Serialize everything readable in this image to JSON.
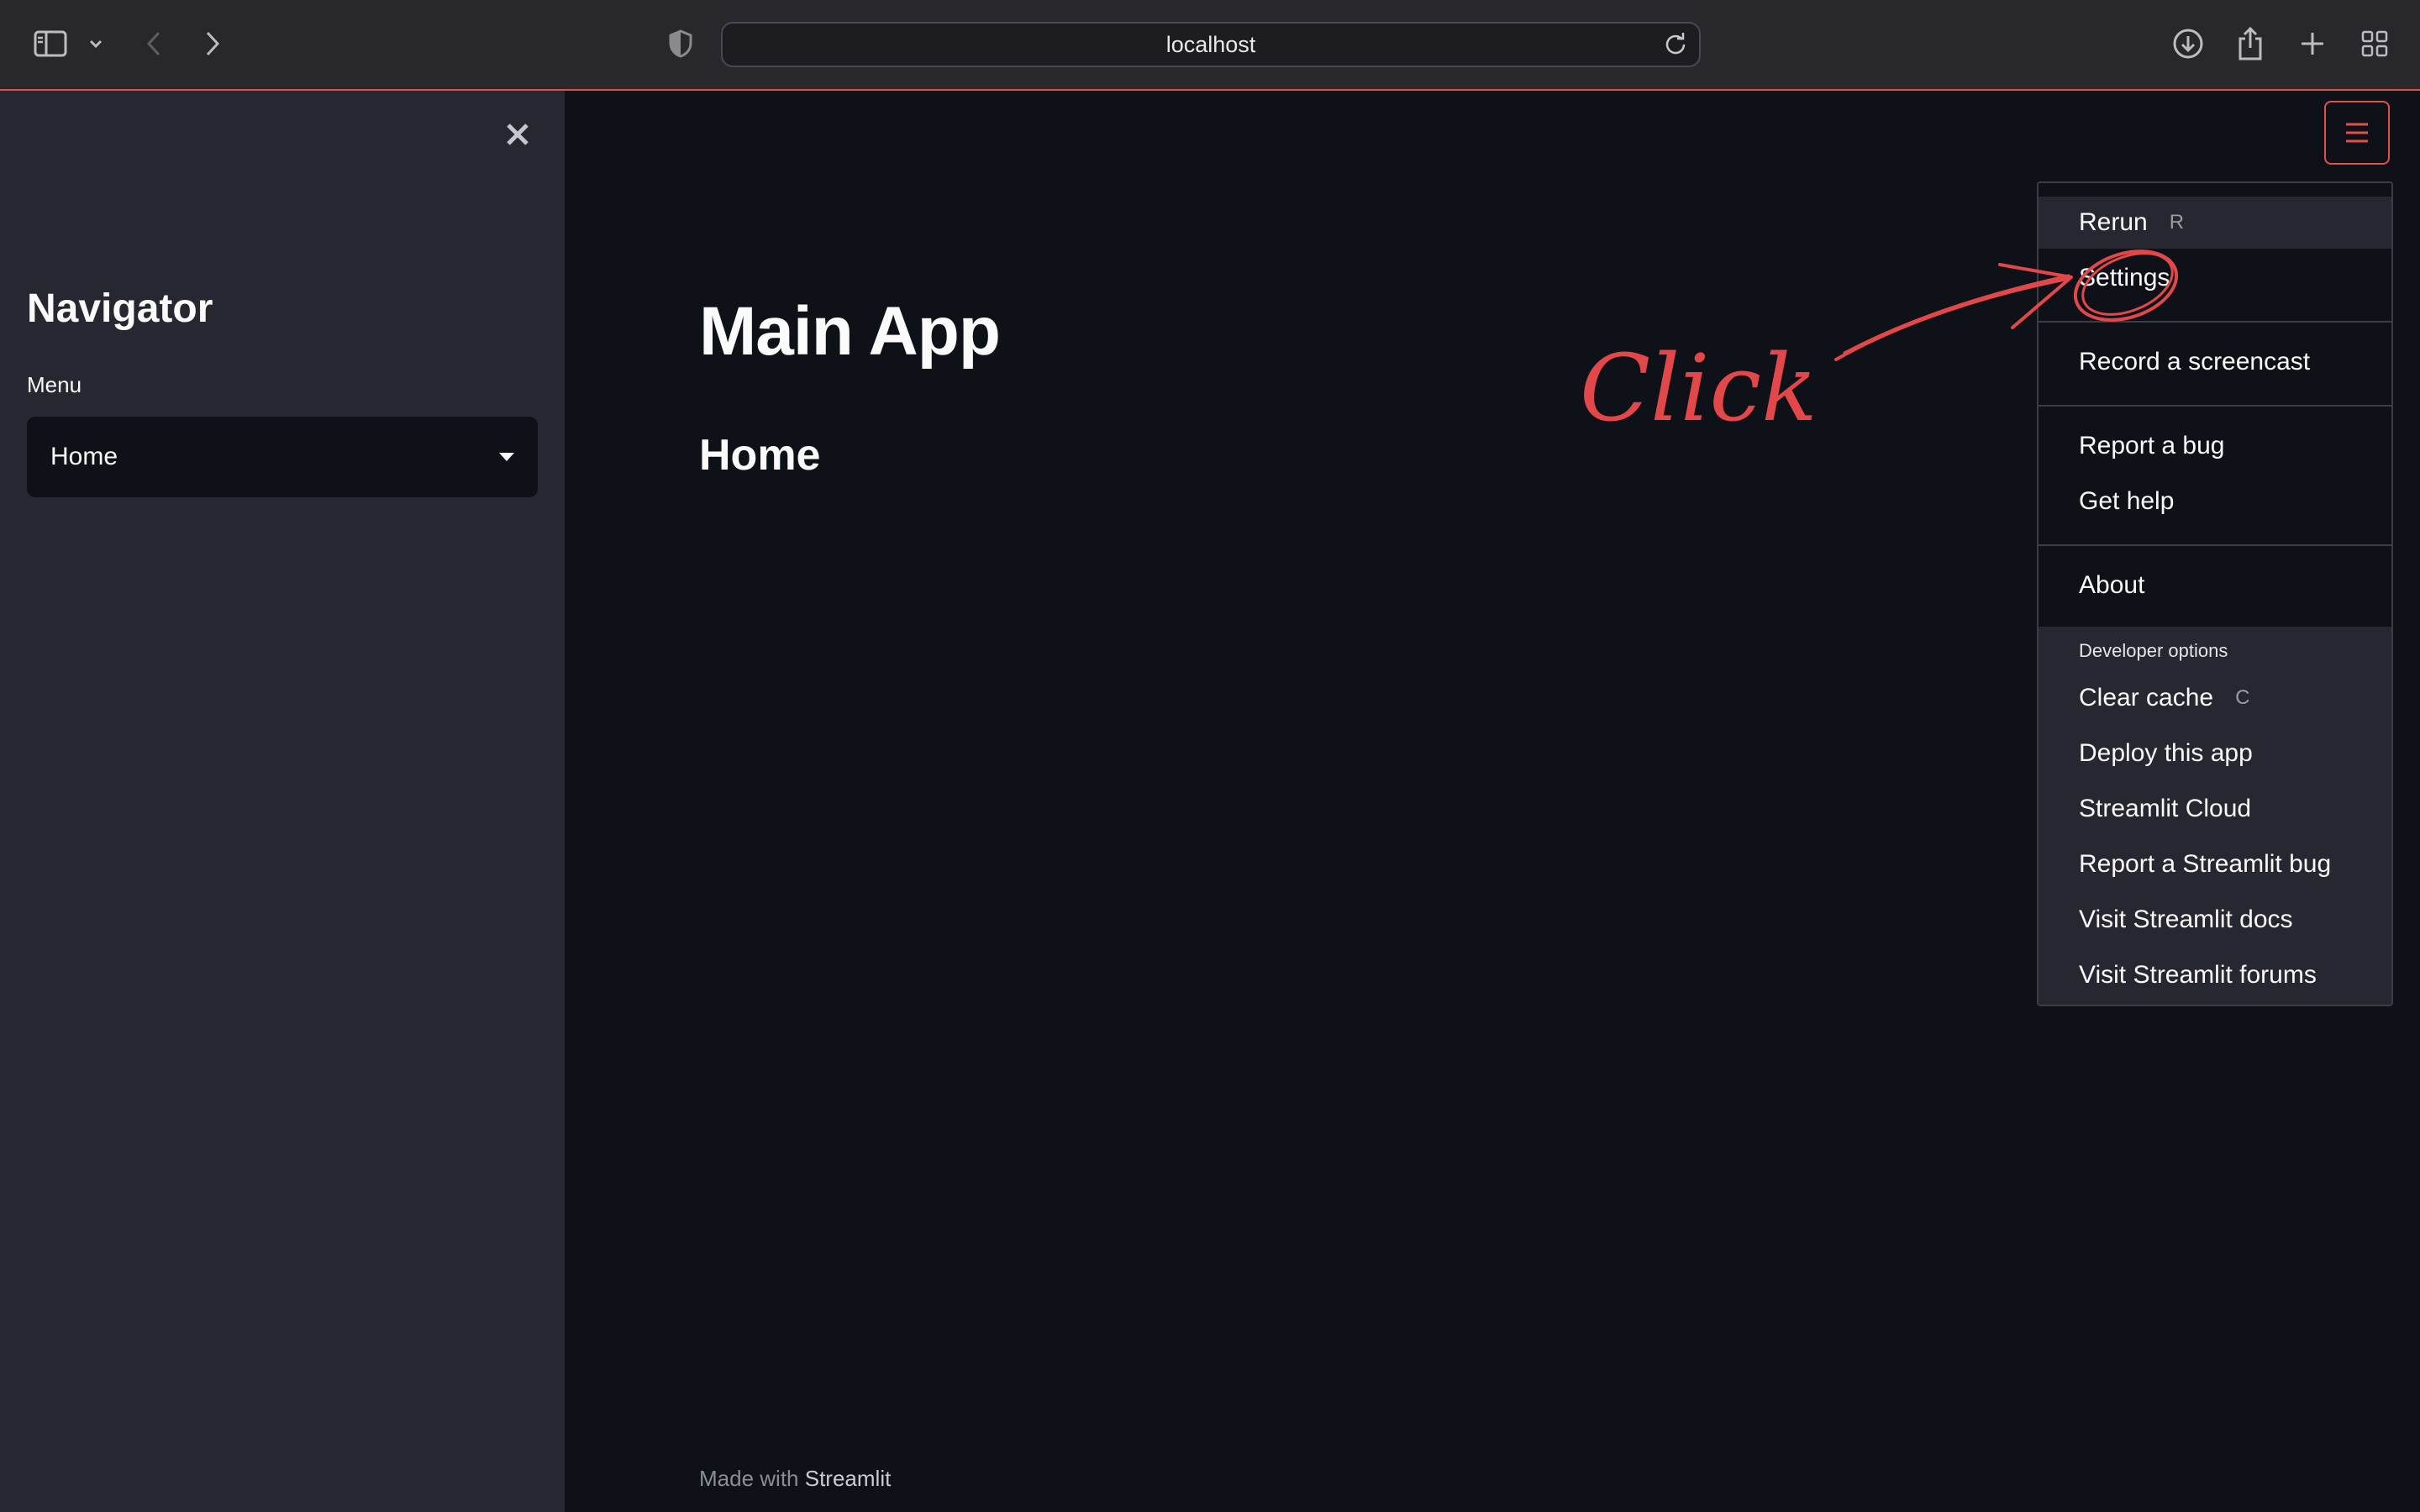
{
  "browser": {
    "url": "localhost",
    "icons": [
      "sidebar-toggle-icon",
      "chevron-down-icon",
      "back-icon",
      "forward-icon",
      "shield-icon",
      "reload-icon",
      "download-icon",
      "share-icon",
      "new-tab-icon",
      "tab-overview-icon"
    ]
  },
  "sidebar": {
    "title": "Navigator",
    "menu_label": "Menu",
    "select_value": "Home",
    "icons": [
      "close-icon",
      "caret-down-icon"
    ]
  },
  "main": {
    "title": "Main App",
    "subtitle": "Home",
    "footer_prefix": "Made with",
    "footer_brand": "Streamlit"
  },
  "menu": {
    "items": [
      {
        "label": "Rerun",
        "key": "R"
      },
      {
        "label": "Settings"
      },
      {
        "label": "Record a screencast"
      },
      {
        "label": "Report a bug"
      },
      {
        "label": "Get help"
      },
      {
        "label": "About"
      }
    ],
    "developer_label": "Developer options",
    "developer_items": [
      {
        "label": "Clear cache",
        "key": "C"
      },
      {
        "label": "Deploy this app"
      },
      {
        "label": "Streamlit Cloud"
      },
      {
        "label": "Report a Streamlit bug"
      },
      {
        "label": "Visit Streamlit docs"
      },
      {
        "label": "Visit Streamlit forums"
      }
    ]
  },
  "annotation": {
    "text": "Click",
    "color": "#e2484a"
  },
  "colors": {
    "accent": "#e2504a",
    "app_bg": "#0e1117",
    "sidebar_bg": "#262730",
    "chrome_bg": "#28272c"
  }
}
